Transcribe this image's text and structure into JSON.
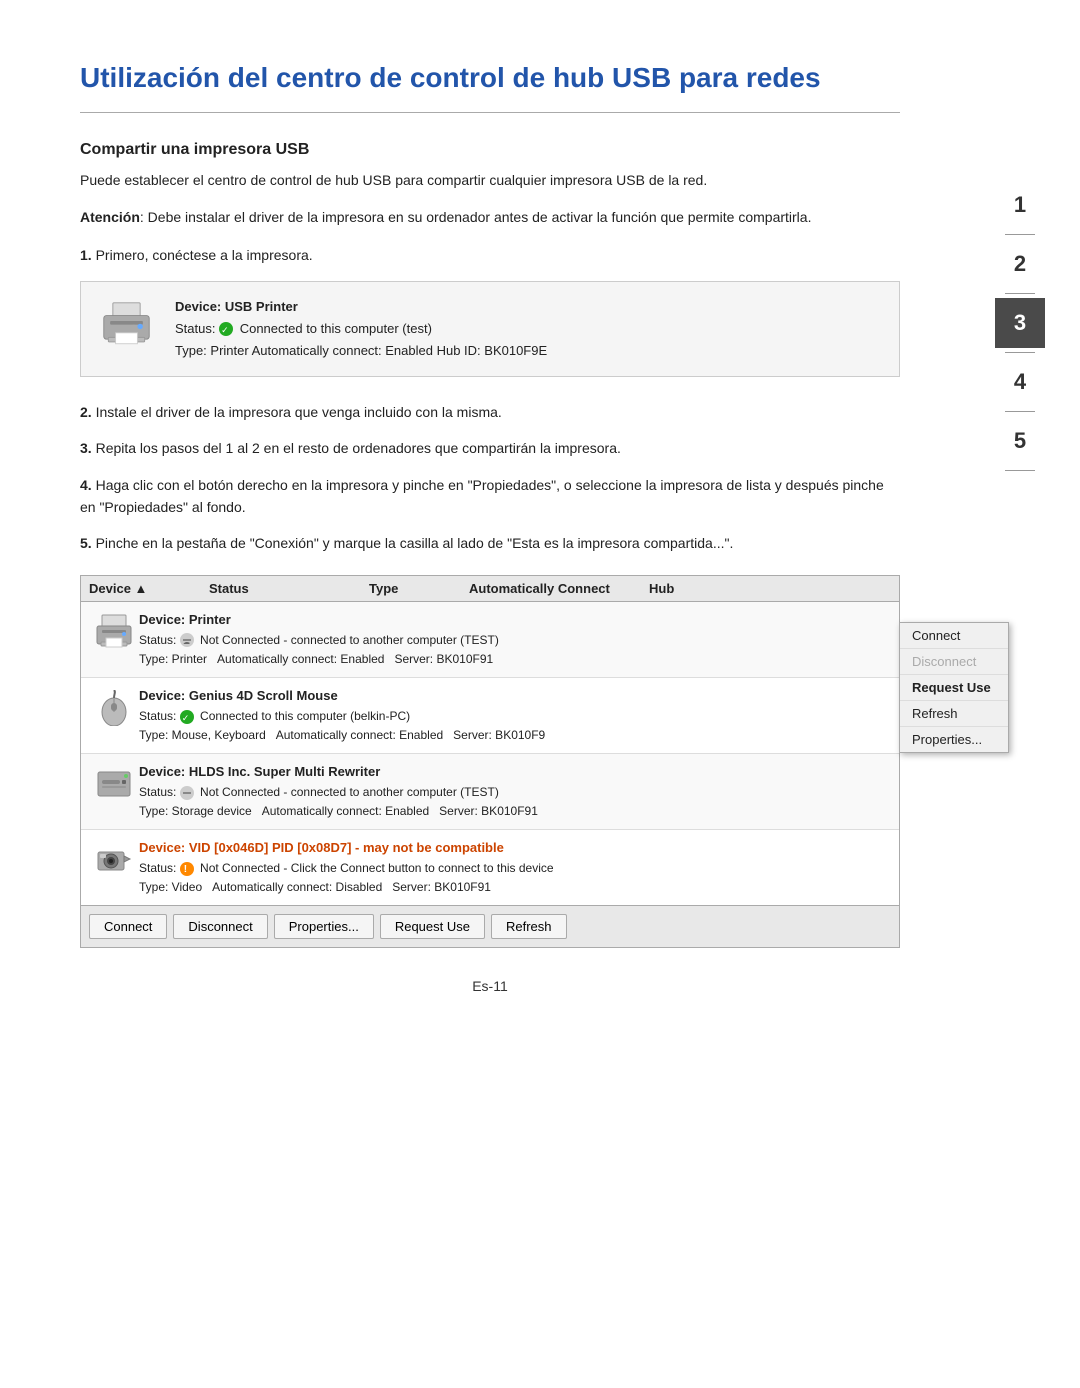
{
  "title": "Utilización del centro de control de hub USB para redes",
  "title_divider": true,
  "section_heading": "Compartir una impresora USB",
  "section_text": "Puede establecer el centro de control de hub USB para compartir cualquier impresora USB de la red.",
  "attention_label": "Atención",
  "attention_text": ": Debe instalar el driver de la impresora en su ordenador antes de activar la función que permite compartirla.",
  "step1_label": "1.",
  "step1_text": "Primero, conéctese a la impresora.",
  "device_box": {
    "device_name": "Device: USB Printer",
    "status_text": "Connected to this computer (test)",
    "type_text": "Type: Printer   Automatically connect: Enabled   Hub ID: BK010F9E"
  },
  "step2_label": "2.",
  "step2_text": "Instale el driver de la impresora que venga incluido con la misma.",
  "step3_label": "3.",
  "step3_text": "Repita los pasos del 1 al 2 en el resto de ordenadores que compartirán la impresora.",
  "step4_label": "4.",
  "step4_text": "Haga clic con el botón derecho en la impresora y pinche en \"Propiedades\", o seleccione la impresora de lista y después pinche en \"Propiedades\" al fondo.",
  "step5_label": "5.",
  "step5_text": "Pinche en la pestaña de \"Conexión\" y marque la casilla al lado de \"Esta es la impresora compartida...\".",
  "table": {
    "headers": [
      "Device",
      "Status",
      "Type",
      "Automatically Connect",
      "Hub"
    ],
    "rows": [
      {
        "icon": "printer",
        "device_name": "Device: Printer",
        "status_icon": "not-connected-user",
        "status_text": "Not Connected - connected to another computer (TEST)",
        "type_text": "Type: Printer   Automatically connect: Enabled   Server: BK010F91"
      },
      {
        "icon": "mouse",
        "device_name": "Device: Genius 4D Scroll Mouse",
        "status_icon": "connected",
        "status_text": "Connected to this computer (belkin-PC)",
        "type_text": "Type: Mouse, Keyboard   Automatically connect: Enabled   Server: BK010F9"
      },
      {
        "icon": "drive",
        "device_name": "Device: HLDS Inc. Super Multi Rewriter",
        "status_icon": "not-connected-user",
        "status_text": "Not Connected - connected to another computer (TEST)",
        "type_text": "Type: Storage device   Automatically connect: Enabled   Server: BK010F91"
      },
      {
        "icon": "camera",
        "device_name": "Device: VID [0x046D] PID [0x08D7] - may not be compatible",
        "status_icon": "warning",
        "status_text": "Not Connected - Click the Connect button to connect to this device",
        "type_text": "Type: Video   Automatically connect: Disabled   Server: BK010F91"
      }
    ]
  },
  "context_menu": {
    "items": [
      {
        "label": "Connect",
        "disabled": false
      },
      {
        "label": "Disconnect",
        "disabled": true
      },
      {
        "label": "Request Use",
        "highlighted": true
      },
      {
        "label": "Refresh",
        "highlighted": false
      },
      {
        "label": "Properties...",
        "disabled": false
      }
    ]
  },
  "bottom_buttons": {
    "connect": "Connect",
    "disconnect": "Disconnect",
    "properties": "Properties...",
    "request_use": "Request Use",
    "refresh": "Refresh"
  },
  "page_number": "Es-11",
  "chapters": [
    {
      "num": "1",
      "active": false
    },
    {
      "num": "2",
      "active": false
    },
    {
      "num": "3",
      "active": true
    },
    {
      "num": "4",
      "active": false
    },
    {
      "num": "5",
      "active": false
    }
  ]
}
